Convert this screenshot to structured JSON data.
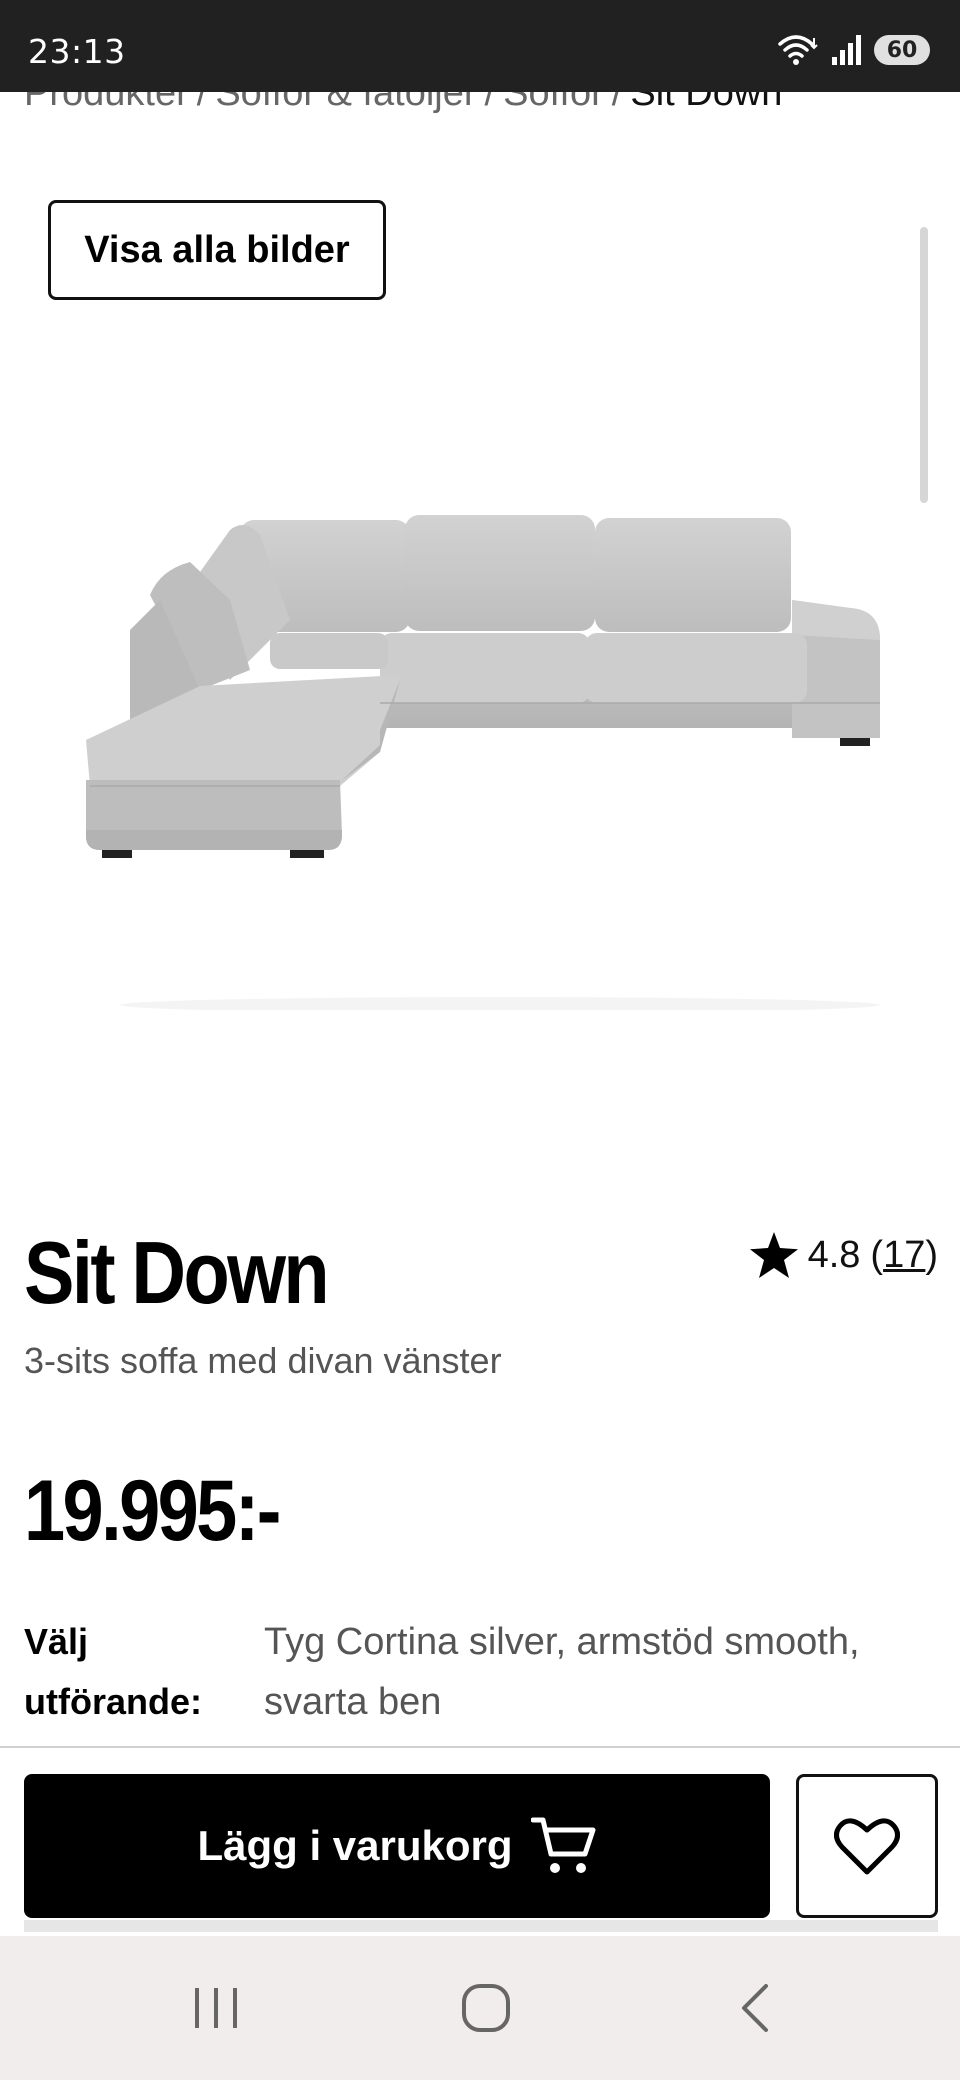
{
  "status_bar": {
    "time": "23:13",
    "battery": "60",
    "icons": [
      "wifi-icon",
      "signal-icon",
      "battery-icon"
    ]
  },
  "breadcrumb": {
    "items": [
      "Produkter",
      "Soffor & fåtöljer",
      "Soffor"
    ],
    "separator": "/",
    "current": "Sit Down"
  },
  "gallery": {
    "view_all_label": "Visa alla bilder",
    "image": "sofa-image"
  },
  "product": {
    "title": "Sit Down",
    "subtitle": "3-sits soffa med divan vänster",
    "rating": "4.8",
    "rating_count": "17",
    "price": "19.995:-"
  },
  "variant": {
    "label_line1": "Välj",
    "label_line2": "utförande:",
    "value_line1": "Tyg Cortina silver, armstöd smooth,",
    "value_line2": "svarta ben"
  },
  "actions": {
    "add_to_cart_label": "Lägg i varukorg",
    "cart_icon": "cart-icon",
    "wishlist_icon": "heart-icon"
  },
  "nav": {
    "buttons": [
      "recent-apps-icon",
      "home-icon",
      "back-icon"
    ]
  },
  "colors": {
    "status_bar": "#212121",
    "primary_button": "#000000",
    "text_muted": "#555555",
    "nav_bar": "#f1eded"
  }
}
